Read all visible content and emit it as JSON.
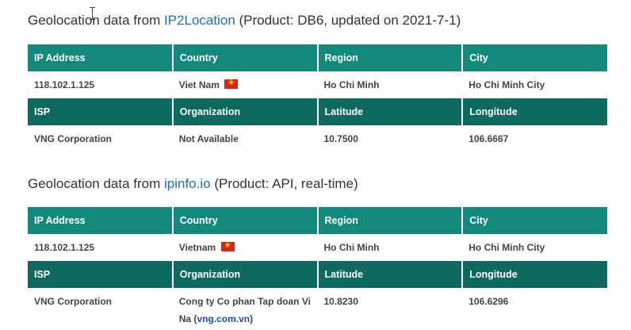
{
  "section1": {
    "heading_prefix": "Geolocation data from ",
    "heading_link": "IP2Location",
    "heading_suffix": " (Product: DB6, updated on 2021-7-1)",
    "headers1": [
      "IP Address",
      "Country",
      "Region",
      "City"
    ],
    "values1": {
      "ip": "118.102.1.125",
      "country": "Viet Nam",
      "region": "Ho Chi Minh",
      "city": "Ho Chi Minh City"
    },
    "headers2": [
      "ISP",
      "Organization",
      "Latitude",
      "Longitude"
    ],
    "values2": {
      "isp": "VNG Corporation",
      "organization": "Not Available",
      "latitude": "10.7500",
      "longitude": "106.6667"
    }
  },
  "section2": {
    "heading_prefix": "Geolocation data from ",
    "heading_link": "ipinfo.io",
    "heading_suffix": " (Product: API, real-time)",
    "headers1": [
      "IP Address",
      "Country",
      "Region",
      "City"
    ],
    "values1": {
      "ip": "118.102.1.125",
      "country": "Vietnam",
      "region": "Ho Chi Minh",
      "city": "Ho Chi Minh City"
    },
    "headers2": [
      "ISP",
      "Organization",
      "Latitude",
      "Longitude"
    ],
    "values2": {
      "isp": "VNG Corporation",
      "organization_prefix": "Cong ty Co phan Tap doan Vi Na (",
      "organization_link": "vng.com.vn",
      "organization_suffix": ")",
      "latitude": "10.8230",
      "longitude": "106.6296"
    }
  },
  "colors": {
    "header_teal": "#13897c",
    "header_dark_teal": "#0e6a5e",
    "link_blue": "#1a6fc1"
  },
  "icons": {
    "flag": "vietnam-flag-icon",
    "cursor": "text-cursor-icon"
  }
}
